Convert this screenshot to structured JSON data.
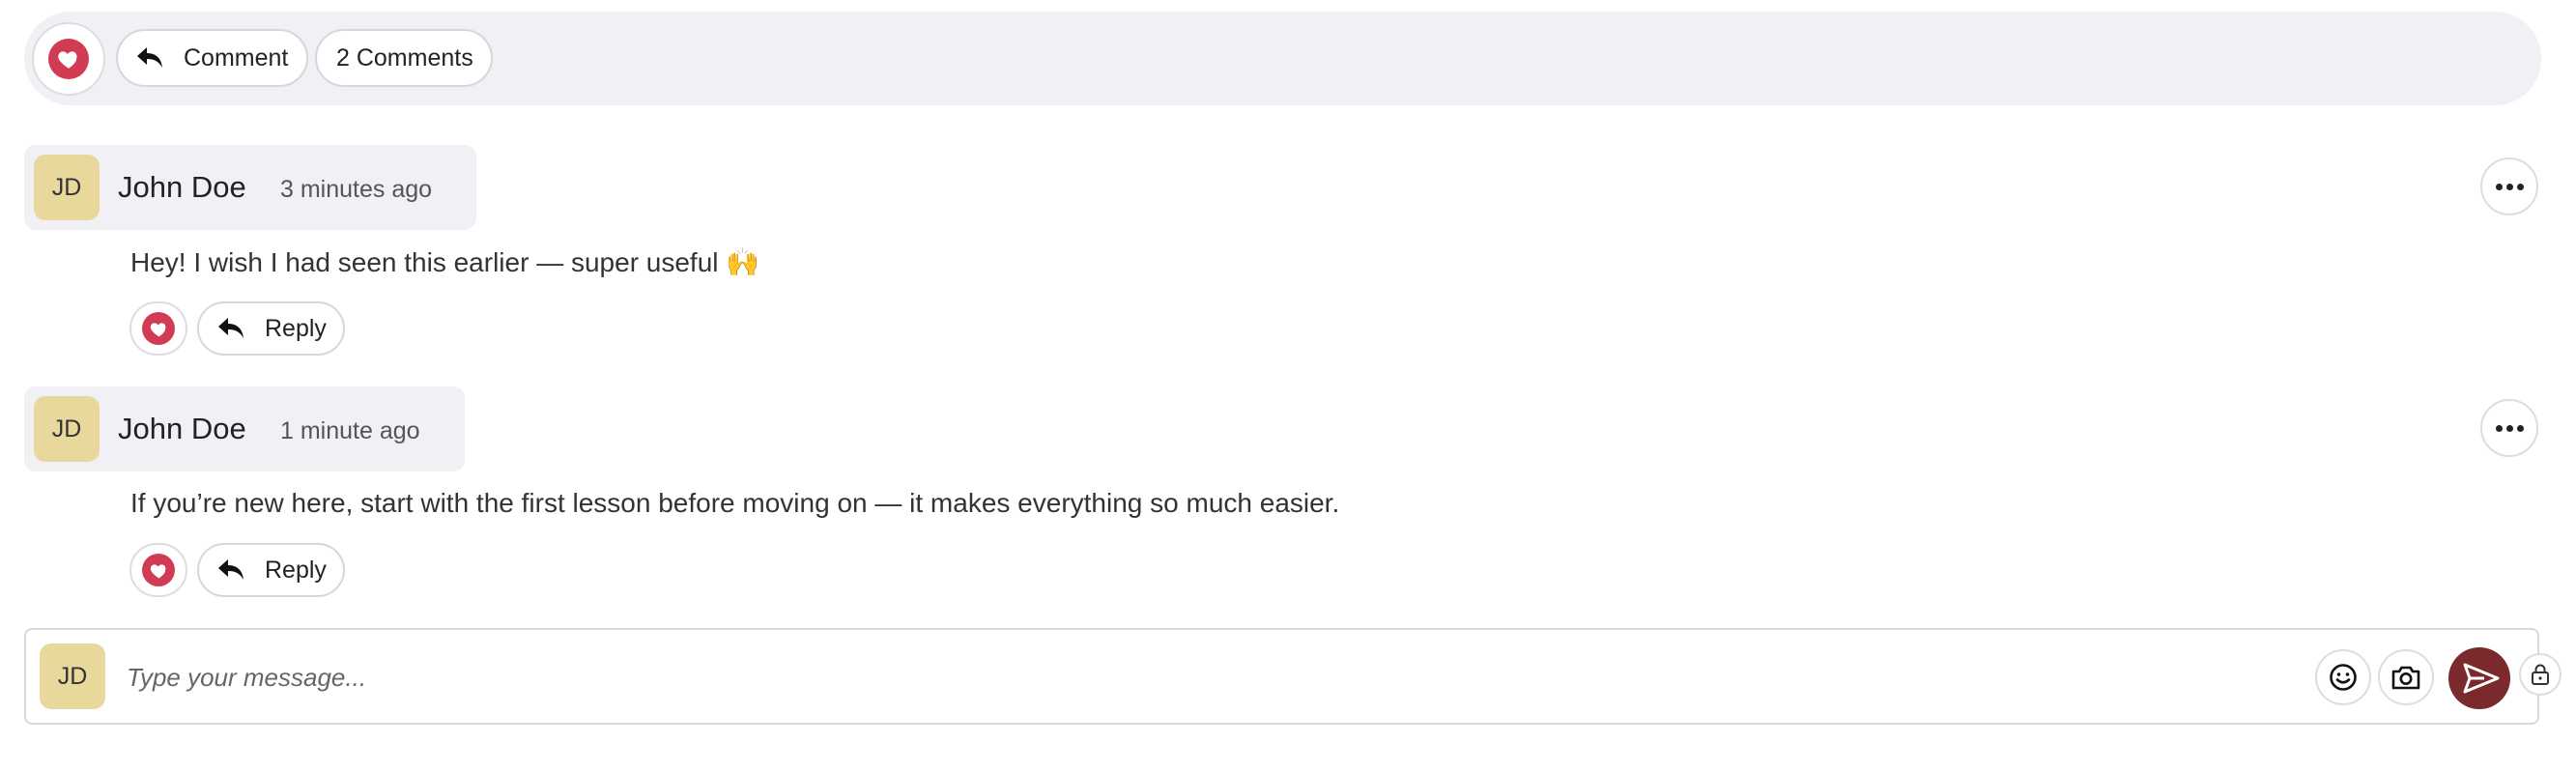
{
  "action_bar": {
    "comment_label": "Comment",
    "comments_count_label": "2 Comments"
  },
  "comments": [
    {
      "initials": "JD",
      "author": "John Doe",
      "time": "3 minutes ago",
      "text": "Hey! I wish I had seen this earlier — super useful 🙌",
      "reply_label": "Reply"
    },
    {
      "initials": "JD",
      "author": "John Doe",
      "time": "1 minute ago",
      "text": "If you’re new here, start with the first lesson before moving on — it makes everything so much easier.",
      "reply_label": "Reply"
    }
  ],
  "composer": {
    "initials": "JD",
    "placeholder": "Type your message..."
  },
  "icons": {
    "heart": "heart-icon",
    "reply": "reply-arrow-icon",
    "more": "more-horizontal-icon",
    "emoji": "emoji-icon",
    "camera": "camera-icon",
    "send": "send-icon",
    "lock": "lock-icon"
  },
  "colors": {
    "heart": "#d23b54",
    "send": "#7a2a2d",
    "avatar": "#e8d89c",
    "bar_bg": "#f1f0f5"
  }
}
